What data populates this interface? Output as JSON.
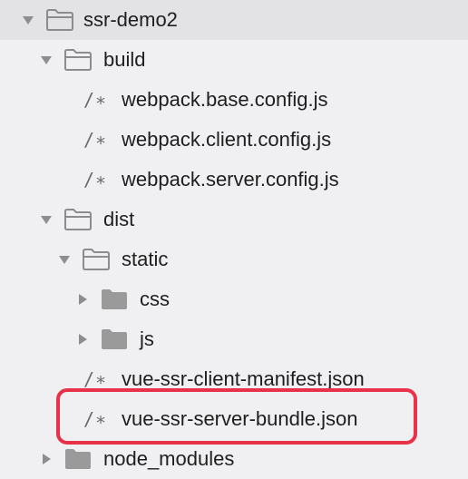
{
  "tree": {
    "root": {
      "label": "ssr-demo2",
      "icon": "folder-open-icon",
      "expanded": true
    },
    "build": {
      "label": "build",
      "icon": "folder-open-icon",
      "expanded": true,
      "files": [
        {
          "glyph": "/∗",
          "label": "webpack.base.config.js"
        },
        {
          "glyph": "/∗",
          "label": "webpack.client.config.js"
        },
        {
          "glyph": "/∗",
          "label": "webpack.server.config.js"
        }
      ]
    },
    "dist": {
      "label": "dist",
      "icon": "folder-open-icon",
      "expanded": true,
      "static": {
        "label": "static",
        "icon": "folder-open-icon",
        "expanded": true,
        "folders": [
          {
            "label": "css",
            "icon": "folder-closed-icon",
            "expanded": false
          },
          {
            "label": "js",
            "icon": "folder-closed-icon",
            "expanded": false
          }
        ]
      },
      "files": [
        {
          "glyph": "/∗",
          "label": "vue-ssr-client-manifest.json"
        },
        {
          "glyph": "/∗",
          "label": "vue-ssr-server-bundle.json",
          "highlighted": true
        }
      ]
    },
    "node_modules": {
      "label": "node_modules",
      "icon": "folder-closed-icon",
      "expanded": false
    }
  },
  "colors": {
    "background": "#f0f0f2",
    "selected_row": "#e3e3e6",
    "folder_outline": "#8c8c8c",
    "folder_fill": "#9a9a9a",
    "disclosure": "#8e8e8e",
    "highlight": "#e8324a"
  }
}
